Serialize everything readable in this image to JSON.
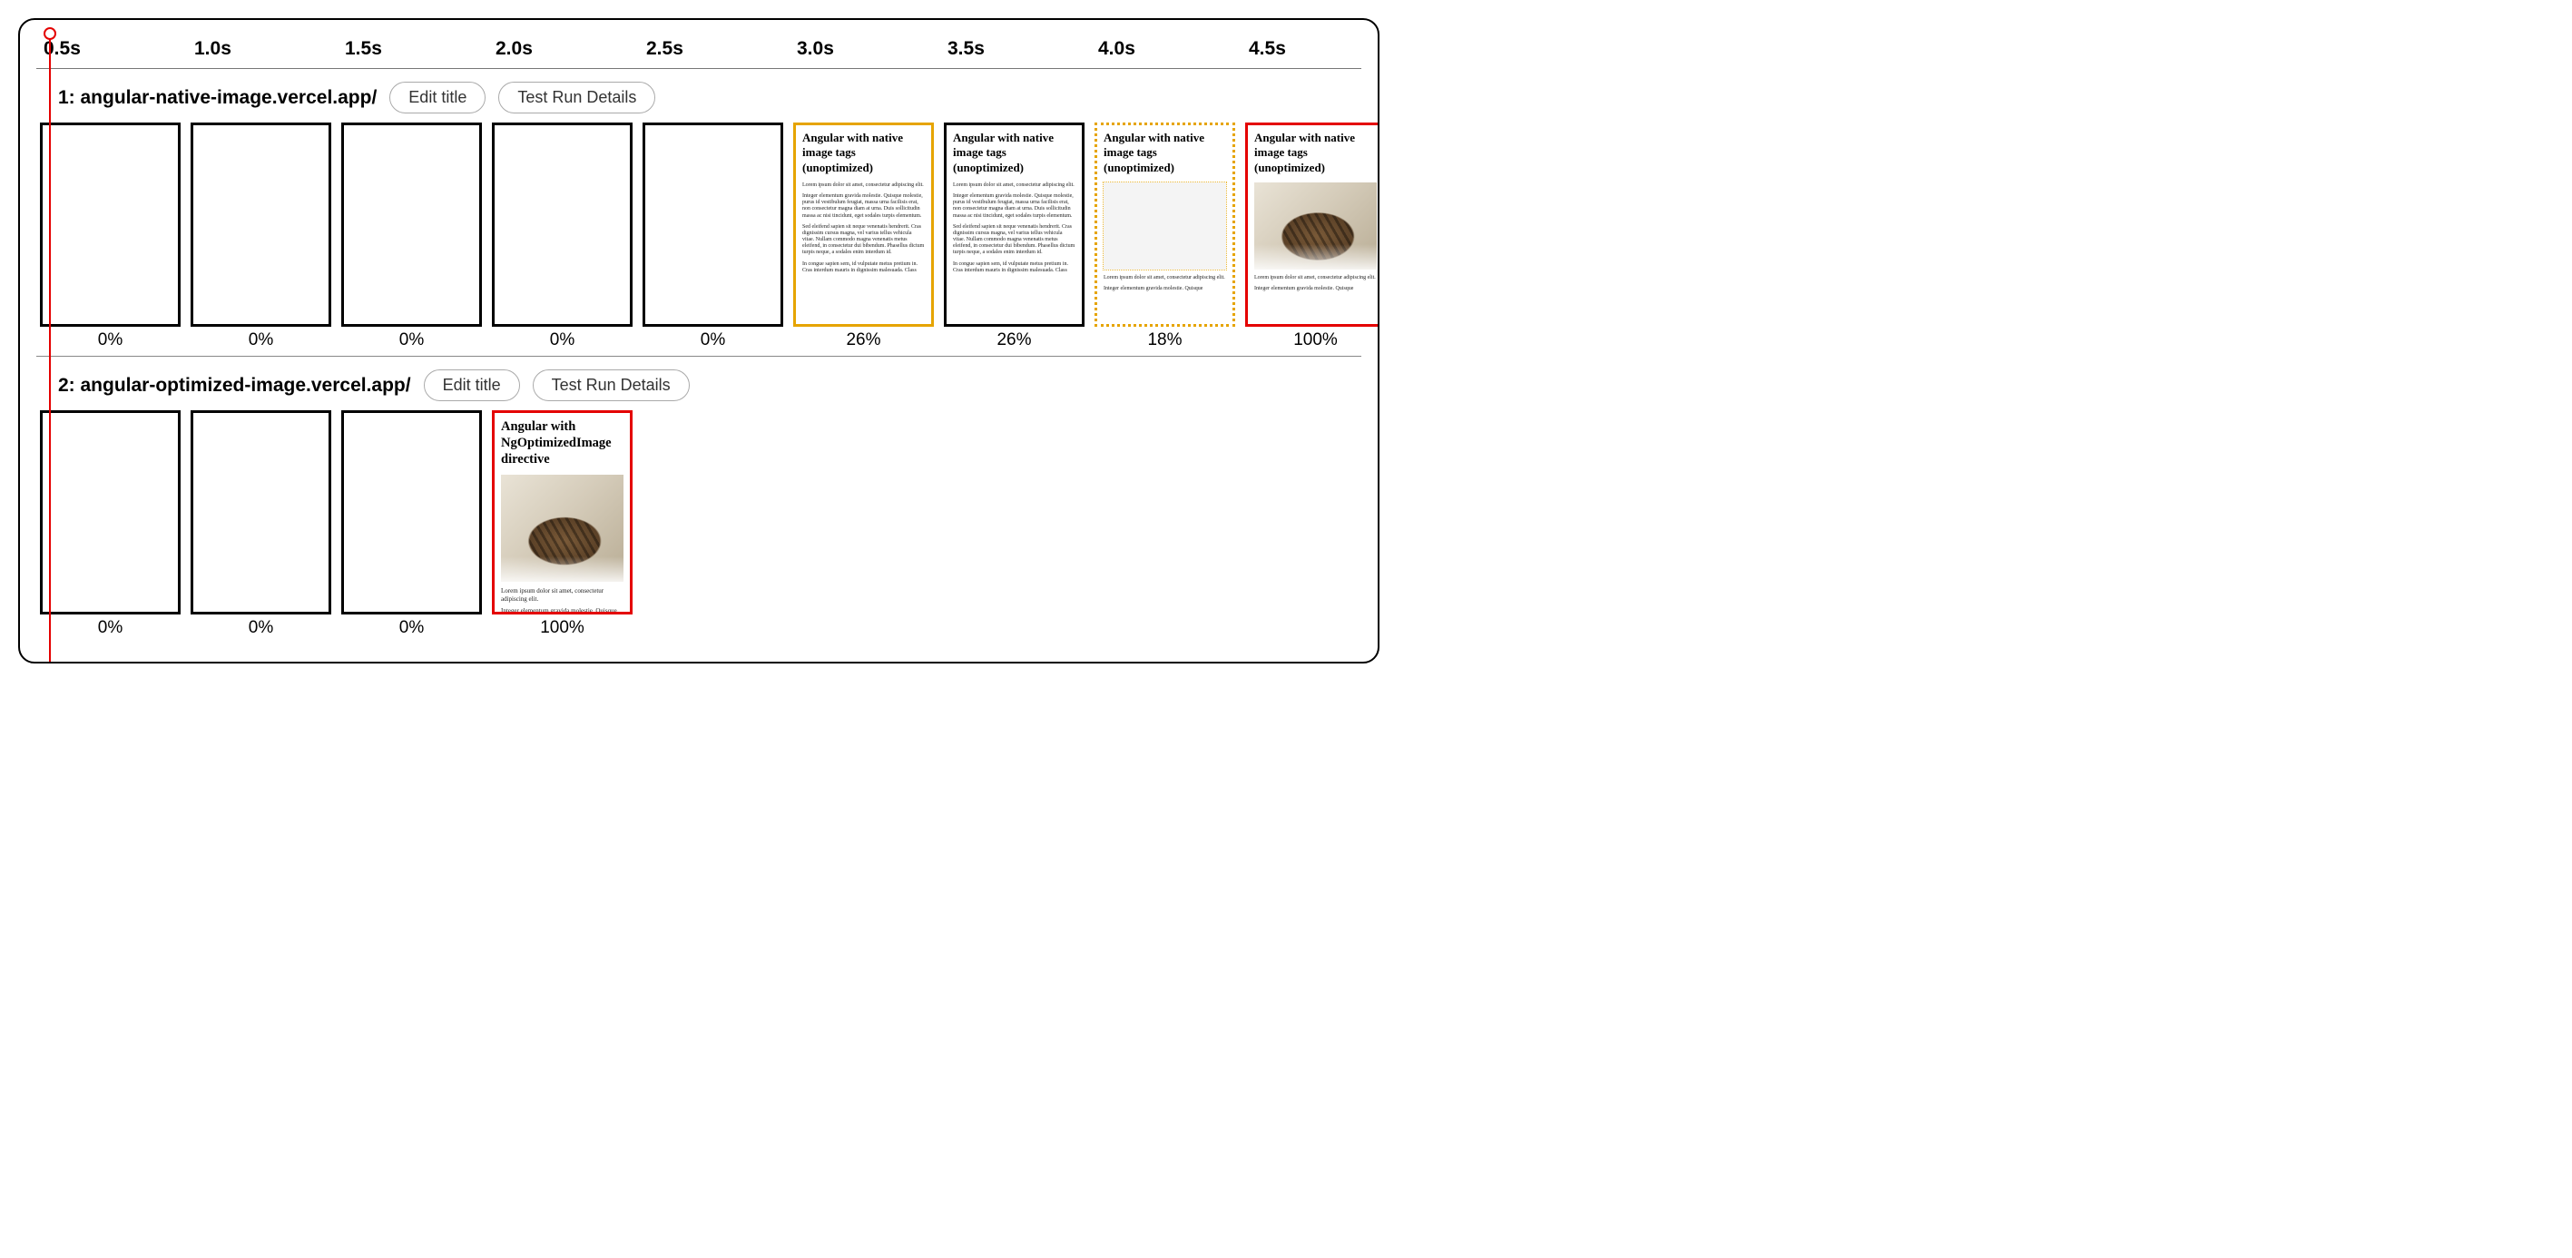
{
  "ruler": {
    "ticks": [
      "0.5s",
      "1.0s",
      "1.5s",
      "2.0s",
      "2.5s",
      "3.0s",
      "3.5s",
      "4.0s",
      "4.5s"
    ]
  },
  "buttons": {
    "edit_title": "Edit title",
    "test_run_details": "Test Run Details"
  },
  "rows": [
    {
      "label": "1: angular-native-image.vercel.app/",
      "frames": [
        {
          "pct": "0%",
          "kind": "blank"
        },
        {
          "pct": "0%",
          "kind": "blank"
        },
        {
          "pct": "0%",
          "kind": "blank"
        },
        {
          "pct": "0%",
          "kind": "blank"
        },
        {
          "pct": "0%",
          "kind": "blank"
        },
        {
          "pct": "26%",
          "kind": "docA-text",
          "border": "orange"
        },
        {
          "pct": "26%",
          "kind": "docA-text",
          "border": "black"
        },
        {
          "pct": "18%",
          "kind": "docA-img-outline",
          "border": "orange-dotted"
        },
        {
          "pct": "100%",
          "kind": "docA-img",
          "border": "red"
        }
      ]
    },
    {
      "label": "2: angular-optimized-image.vercel.app/",
      "frames": [
        {
          "pct": "0%",
          "kind": "blank"
        },
        {
          "pct": "0%",
          "kind": "blank"
        },
        {
          "pct": "0%",
          "kind": "blank"
        },
        {
          "pct": "100%",
          "kind": "docB-img",
          "border": "red"
        }
      ]
    }
  ],
  "docA": {
    "title": "Angular with native image tags (unoptimized)",
    "paras": [
      "Lorem ipsum dolor sit amet, consectetur adipiscing elit.",
      "Integer elementum gravida molestie. Quisque molestie, purus id vestibulum feugiat, massa urna facilisis erat, non consectetur magna diam at urna. Duis sollicitudin massa ac nisi tincidunt, eget sodales turpis elementum.",
      "Sed eleifend sapien sit neque venenatis hendrerit. Cras dignissim cursus magna, vel varius tellus vehicula vitae. Nullam commodo magna venenatis metus eleifend, in consectetur dui bibendum. Phasellus dictum turpis neque, a sodales enim interdum id.",
      "In congue sapien sem, id vulputate metus pretium in. Cras interdum mauris in dignissim malesuada. Class"
    ],
    "after_img_paras": [
      "Lorem ipsum dolor sit amet, consectetur adipiscing elit.",
      "Integer elementum gravida molestie. Quisque"
    ]
  },
  "docB": {
    "title": "Angular with NgOptimizedImage directive",
    "after_img_paras": [
      "Lorem ipsum dolor sit amet, consectetur adipiscing elit.",
      "Integer elementum gravida molestie. Quisque"
    ]
  }
}
